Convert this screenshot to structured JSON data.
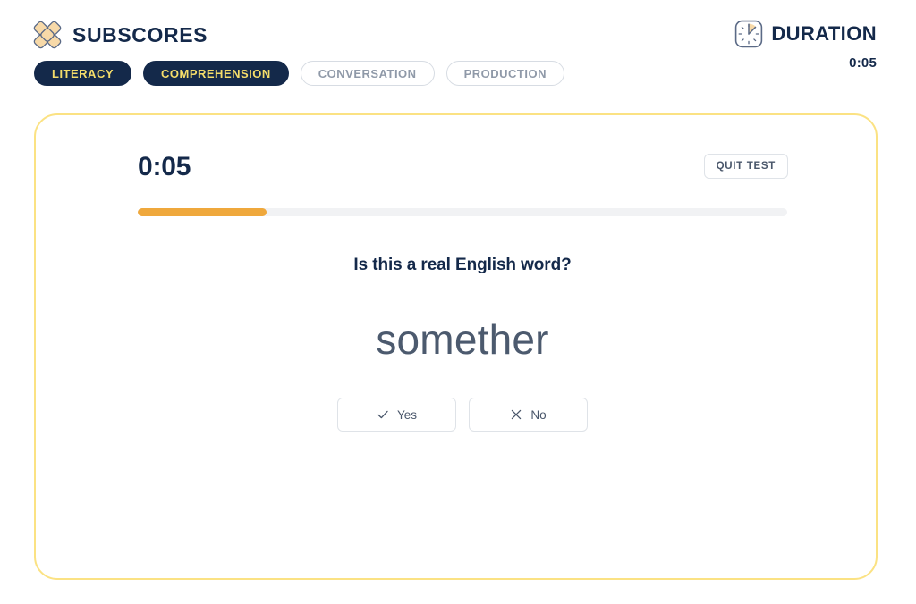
{
  "header": {
    "brand_title": "SUBSCORES",
    "logo_icon": "diamond-cluster-logo",
    "duration": {
      "icon": "clock-icon",
      "label": "DURATION",
      "value": "0:05"
    }
  },
  "tabs": [
    {
      "label": "LITERACY",
      "state": "active"
    },
    {
      "label": "COMPREHENSION",
      "state": "active"
    },
    {
      "label": "CONVERSATION",
      "state": "inactive"
    },
    {
      "label": "PRODUCTION",
      "state": "inactive"
    }
  ],
  "test": {
    "timer": "0:05",
    "quit_label": "QUIT TEST",
    "progress_percent": 19.8,
    "question": "Is this a real English word?",
    "prompt_word": "somether",
    "answers": [
      {
        "label": "Yes",
        "icon": "check-icon"
      },
      {
        "label": "No",
        "icon": "x-icon"
      }
    ]
  },
  "colors": {
    "navy": "#14294a",
    "yellow": "#f5dd6a",
    "card_border": "#fbe283",
    "progress_fill": "#efa83c",
    "progress_track": "#f1f2f4",
    "muted_text": "#8f99a8",
    "word_text": "#4c5a6e"
  }
}
